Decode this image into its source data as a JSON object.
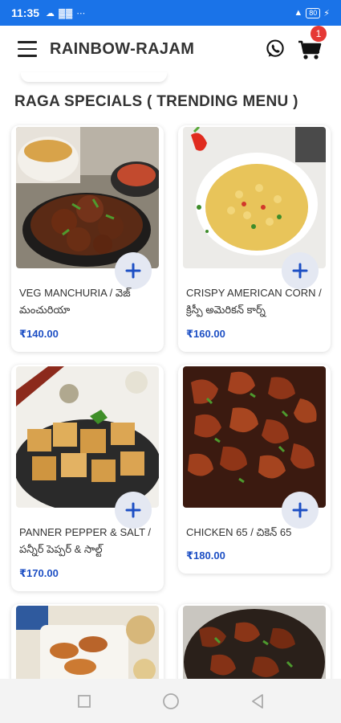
{
  "status_bar": {
    "time": "11:35",
    "left_icons": "☁ ▓▓ ⋯",
    "battery": "80"
  },
  "app": {
    "title": "RAINBOW-RAJAM",
    "cart_count": "1"
  },
  "section": {
    "title": "RAGA SPECIALS ( TRENDING MENU )"
  },
  "items": [
    {
      "name": "VEG MANCHURIA / వెజ్ మంచురియా",
      "price": "₹140.00"
    },
    {
      "name": "CRISPY AMERICAN CORN / క్రిస్పీ అమెరికన్ కార్న్",
      "price": "₹160.00"
    },
    {
      "name": "PANNER PEPPER & SALT / పన్నీర్ పెప్పర్ & సాల్ట్",
      "price": "₹170.00"
    },
    {
      "name": "CHICKEN 65 / చికెన్ 65",
      "price": "₹180.00"
    }
  ],
  "colors": {
    "status_bar": "#1a73e8",
    "price": "#1d4fc4",
    "badge": "#e53935",
    "add_button": "#e4e8f2",
    "add_icon": "#1d4fc4"
  }
}
